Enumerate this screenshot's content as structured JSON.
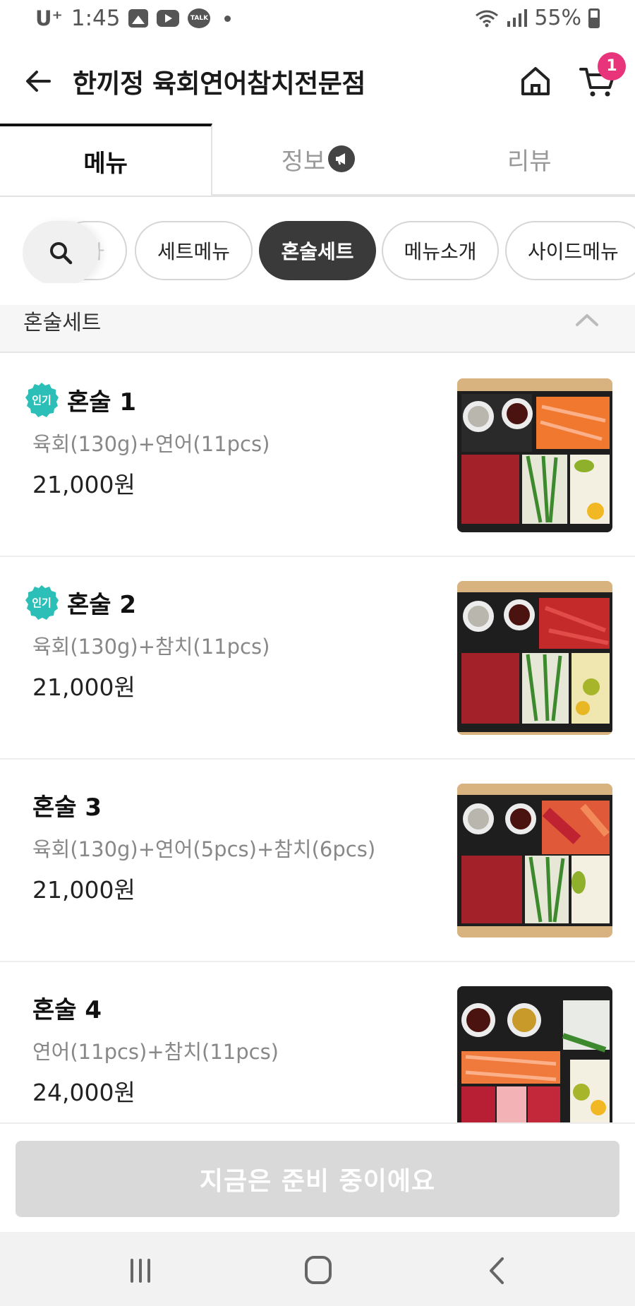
{
  "status_bar": {
    "carrier": "U⁺",
    "time": "1:45",
    "icons": [
      "gallery-icon",
      "youtube-icon",
      "kakaotalk-icon"
    ],
    "talk_label": "TALK",
    "battery": "55%"
  },
  "header": {
    "title": "한끼정 육회연어참치전문점",
    "cart_count": "1"
  },
  "tabs": [
    {
      "label": "메뉴",
      "active": true
    },
    {
      "label": "정보",
      "active": false
    },
    {
      "label": "리뷰",
      "active": false
    }
  ],
  "categories": {
    "partial_label": "ㅏ",
    "items": [
      {
        "label": "세트메뉴",
        "active": false
      },
      {
        "label": "혼술세트",
        "active": true
      },
      {
        "label": "메뉴소개",
        "active": false
      },
      {
        "label": "사이드메뉴",
        "active": false
      }
    ]
  },
  "section": {
    "title": "혼술세트"
  },
  "menu_items": [
    {
      "name": "혼술 1",
      "badge": "인기",
      "description": "육회(130g)+연어(11pcs)",
      "price": "21,000원"
    },
    {
      "name": "혼술 2",
      "badge": "인기",
      "description": "육회(130g)+참치(11pcs)",
      "price": "21,000원"
    },
    {
      "name": "혼술 3",
      "badge": "",
      "description": "육회(130g)+연어(5pcs)+참치(6pcs)",
      "price": "21,000원"
    },
    {
      "name": "혼술 4",
      "badge": "",
      "description": "연어(11pcs)+참치(11pcs)",
      "price": "24,000원"
    }
  ],
  "action": {
    "label": "지금은 준비 중이에요"
  },
  "colors": {
    "badge_teal": "#2bbfb7",
    "cart_badge": "#e8347a",
    "active_chip": "#3a3a3a",
    "disabled_button": "#d9d9d9"
  }
}
